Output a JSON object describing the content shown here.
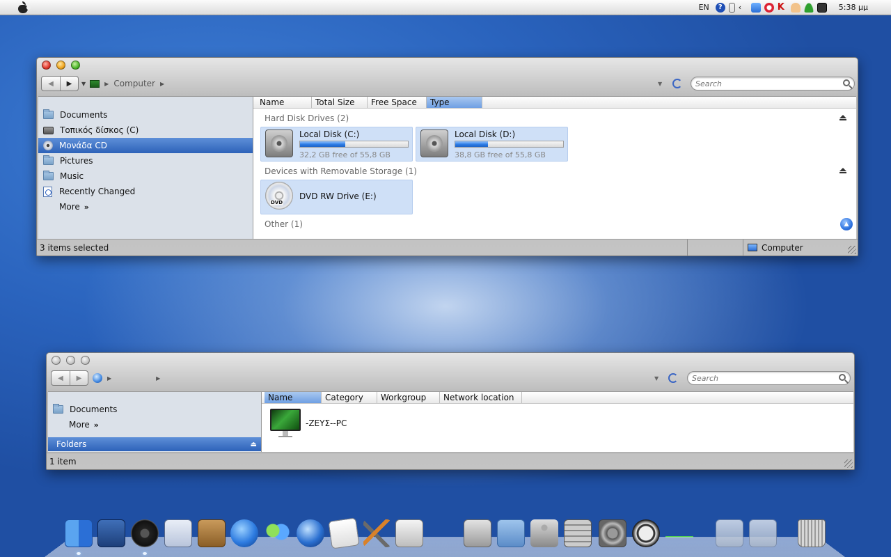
{
  "menubar": {
    "language": "EN",
    "clock": "5:38 μμ",
    "tray_icons": [
      "help-icon",
      "arrows-icon",
      "back-icon",
      "network-icon",
      "shield-icon",
      "kaspersky-icon",
      "hand-icon",
      "user-icon",
      "camera-icon"
    ]
  },
  "window_computer": {
    "breadcrumb": [
      "Computer"
    ],
    "search_placeholder": "Search",
    "sidebar": [
      {
        "label": "Documents",
        "icon": "folder-icon"
      },
      {
        "label": "Τοπικός δίσκος (C)",
        "icon": "disk-icon"
      },
      {
        "label": "Μονάδα CD",
        "icon": "cd-icon",
        "selected": true
      },
      {
        "label": "Pictures",
        "icon": "folder-icon"
      },
      {
        "label": "Music",
        "icon": "folder-icon"
      },
      {
        "label": "Recently Changed",
        "icon": "recently-changed-icon"
      }
    ],
    "more_label": "More",
    "columns": [
      "Name",
      "Total Size",
      "Free Space",
      "Type"
    ],
    "sorted_column": "Type",
    "groups": {
      "hard_disks": "Hard Disk Drives (2)",
      "removable": "Devices with Removable Storage (1)",
      "other": "Other (1)"
    },
    "drives": [
      {
        "name": "Local Disk (C:)",
        "free_text": "32,2 GB free of 55,8 GB",
        "used_fraction": 0.42
      },
      {
        "name": "Local Disk (D:)",
        "free_text": "38,8 GB free of 55,8 GB",
        "used_fraction": 0.3
      }
    ],
    "dvd": {
      "name": "DVD RW Drive (E:)",
      "badge": "DVD"
    },
    "status_left": "3 items selected",
    "status_right": "Computer"
  },
  "window_network": {
    "breadcrumb": [
      ""
    ],
    "search_placeholder": "Search",
    "sidebar": [
      {
        "label": "Documents",
        "icon": "folder-icon"
      }
    ],
    "more_label": "More",
    "folders_label": "Folders",
    "columns": [
      "Name",
      "Category",
      "Workgroup",
      "Network location"
    ],
    "sorted_column": "Name",
    "computers": [
      {
        "name": "-ΖΕΥΣ--PC"
      }
    ],
    "status_left": "1 item"
  },
  "dock": {
    "items": [
      "finder-icon",
      "dashboard-icon",
      "gauge-icon",
      "mail-icon",
      "address-book-icon",
      "media-player-icon",
      "messenger-icon",
      "browser-icon",
      "document-icon",
      "tools-icon",
      "museum-icon",
      "scissors-icon",
      "applications-folder-icon",
      "compass-icon",
      "calculator-icon",
      "system-preferences-icon",
      "power-icon",
      "activity-graph-icon",
      "stack-icon",
      "stack-icon",
      "trash-icon"
    ]
  }
}
